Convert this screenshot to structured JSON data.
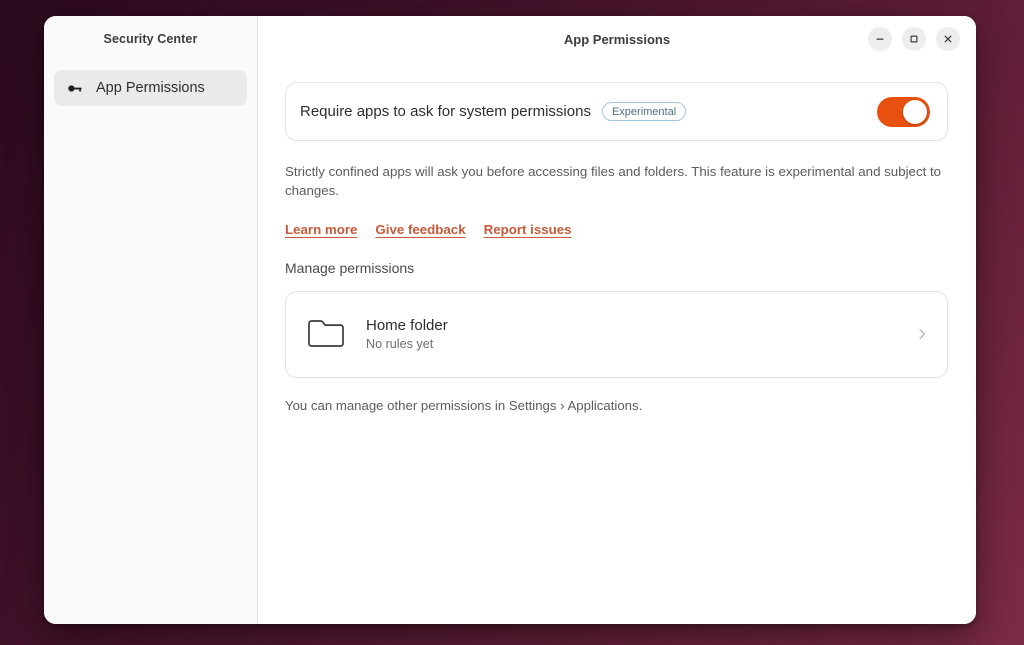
{
  "window": {
    "title": "App Permissions",
    "controls": [
      {
        "name": "minimize",
        "glyph": "–"
      },
      {
        "name": "maximize",
        "glyph": "□"
      },
      {
        "name": "close",
        "glyph": "✕"
      }
    ]
  },
  "sidebar": {
    "header": "Security Center",
    "items": [
      {
        "label": "App Permissions",
        "icon": "key-icon",
        "selected": true
      }
    ]
  },
  "main": {
    "toggle_row": {
      "label": "Require apps to ask for system permissions",
      "badge": "Experimental",
      "switch_state": "on"
    },
    "description": "Strictly confined apps will ask you before accessing files and folders. This feature is experimental and subject to changes.",
    "links": [
      {
        "label": "Learn more"
      },
      {
        "label": "Give feedback"
      },
      {
        "label": "Report issues"
      }
    ],
    "section_label": "Manage permissions",
    "permission_rows": [
      {
        "icon": "folder-icon",
        "title": "Home folder",
        "subtitle": "No rules yet",
        "chevron": "chevron-right-icon"
      }
    ],
    "footnote": "You can manage other permissions in Settings › Applications."
  },
  "colors": {
    "accent": "#e7500f",
    "link": "#c6593a",
    "badge_border": "#9ec8de",
    "badge_text": "#4e6d7c",
    "desktop_bg_start": "#2b0a1d",
    "desktop_bg_end": "#7c2b46",
    "sidebar_bg": "#fafafa",
    "sidebar_selected_bg": "#ebeaea"
  }
}
